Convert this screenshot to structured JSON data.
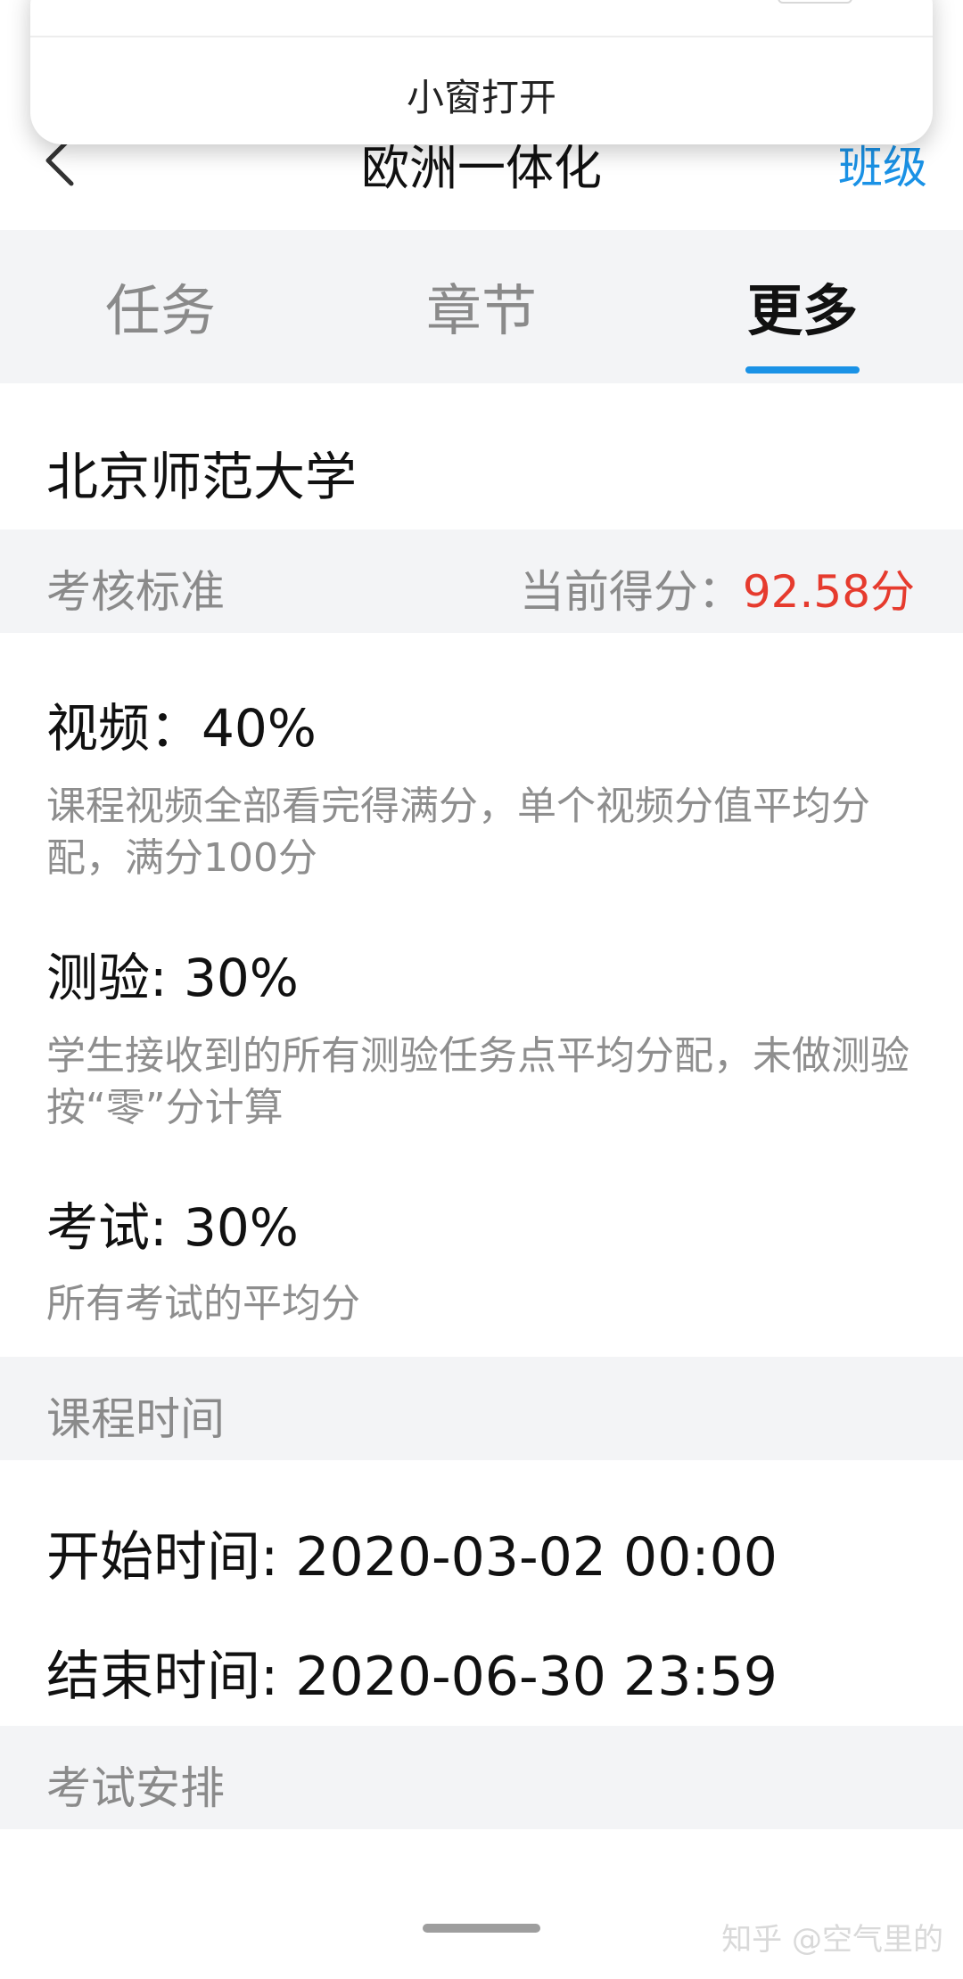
{
  "header": {
    "title": "欧洲一体化",
    "right_link": "班级"
  },
  "popup": {
    "button_label": "小窗打开"
  },
  "tabs": [
    {
      "label": "任务"
    },
    {
      "label": "章节"
    },
    {
      "label": "更多"
    }
  ],
  "active_tab_index": 2,
  "school": {
    "name": "北京师范大学"
  },
  "assessment": {
    "section_title": "考核标准",
    "score_label": "当前得分：",
    "score_value": "92.58分",
    "items": [
      {
        "title": "视频：40%",
        "description": "课程视频全部看完得满分，单个视频分值平均分配，满分100分"
      },
      {
        "title": "测验: 30%",
        "description": "学生接收到的所有测验任务点平均分配，未做测验按“零”分计算"
      },
      {
        "title": "考试: 30%",
        "description": "所有考试的平均分"
      }
    ]
  },
  "course_time": {
    "section_title": "课程时间",
    "start": "开始时间: 2020-03-02 00:00",
    "end": "结束时间: 2020-06-30 23:59"
  },
  "exam_schedule": {
    "section_title": "考试安排"
  },
  "watermark": "知乎 @空气里的",
  "colors": {
    "accent": "#1a92e6",
    "score": "#e63b2e",
    "section_bg": "#f3f4f6",
    "muted_text": "#8a8a8a"
  },
  "icons": {
    "back": "chevron-left-icon"
  }
}
